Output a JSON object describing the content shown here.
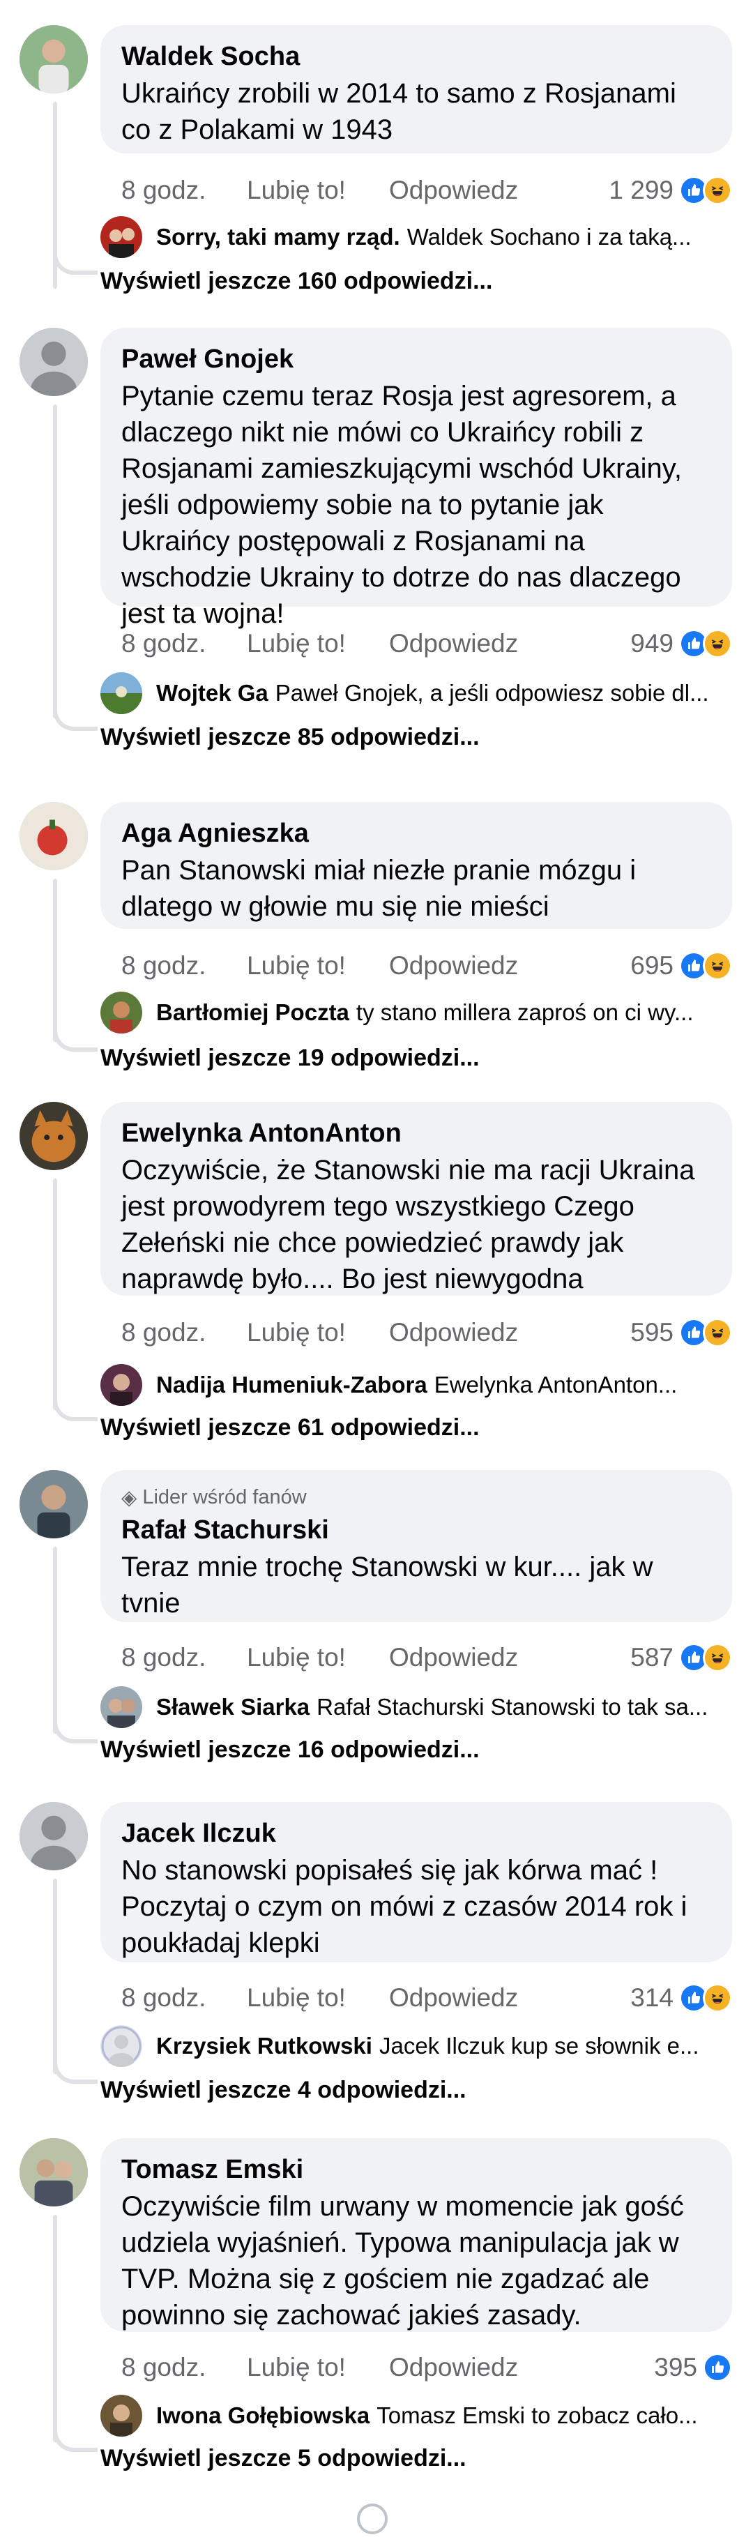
{
  "comments": [
    {
      "author": "Waldek Socha",
      "text": "Ukraińcy zrobili w 2014 to samo z Rosjanami co z Polakami w 1943",
      "time": "8 godz.",
      "like_label": "Lubię to!",
      "reply_label": "Odpowiedz",
      "reaction_count": "1 299",
      "reactions": [
        "like",
        "haha"
      ],
      "reply": {
        "author": "Sorry, taki mamy rząd.",
        "text": "Waldek Sochano i za taką..."
      },
      "more_replies": "Wyświetl jeszcze 160 odpowiedzi..."
    },
    {
      "author": "Paweł Gnojek",
      "text": "Pytanie czemu teraz Rosja jest agresorem, a dlaczego nikt nie mówi co Ukraińcy robili z Rosjanami zamieszkującymi wschód Ukrainy, jeśli odpowiemy sobie na to pytanie jak Ukraińcy postępowali z Rosjanami na wschodzie Ukrainy to dotrze do nas dlaczego jest ta wojna!",
      "time": "8 godz.",
      "like_label": "Lubię to!",
      "reply_label": "Odpowiedz",
      "reaction_count": "949",
      "reactions": [
        "like",
        "haha"
      ],
      "reply": {
        "author": "Wojtek Ga",
        "text": "Paweł Gnojek, a jeśli odpowiesz sobie dl..."
      },
      "more_replies": "Wyświetl jeszcze 85 odpowiedzi..."
    },
    {
      "author": "Aga Agnieszka",
      "text": "Pan Stanowski miał niezłe pranie mózgu i dlatego w głowie mu się nie mieści",
      "time": "8 godz.",
      "like_label": "Lubię to!",
      "reply_label": "Odpowiedz",
      "reaction_count": "695",
      "reactions": [
        "like",
        "haha"
      ],
      "reply": {
        "author": "Bartłomiej Poczta",
        "text": "ty stano millera zaproś on ci wy..."
      },
      "more_replies": "Wyświetl jeszcze 19 odpowiedzi..."
    },
    {
      "author": "Ewelynka AntonAnton",
      "text": "Oczywiście, że Stanowski nie ma racji Ukraina jest prowodyrem tego wszystkiego Czego Zełeński nie chce powiedzieć prawdy jak naprawdę było.... Bo jest niewygodna",
      "time": "8 godz.",
      "like_label": "Lubię to!",
      "reply_label": "Odpowiedz",
      "reaction_count": "595",
      "reactions": [
        "like",
        "haha"
      ],
      "reply": {
        "author": "Nadija Humeniuk-Zabora",
        "text": "Ewelynka AntonAnton..."
      },
      "more_replies": "Wyświetl jeszcze 61 odpowiedzi..."
    },
    {
      "badge": "Lider wśród fanów",
      "author": "Rafał Stachurski",
      "text": "Teraz mnie trochę Stanowski w kur.... jak w tvnie",
      "time": "8 godz.",
      "like_label": "Lubię to!",
      "reply_label": "Odpowiedz",
      "reaction_count": "587",
      "reactions": [
        "like",
        "haha"
      ],
      "reply": {
        "author": "Sławek Siarka",
        "text": "Rafał Stachurski Stanowski to tak sa..."
      },
      "more_replies": "Wyświetl jeszcze 16 odpowiedzi..."
    },
    {
      "author": "Jacek Ilczuk",
      "text": "No stanowski popisałeś się jak kórwa mać ! Poczytaj o czym on mówi z czasów 2014 rok i poukładaj klepki",
      "time": "8 godz.",
      "like_label": "Lubię to!",
      "reply_label": "Odpowiedz",
      "reaction_count": "314",
      "reactions": [
        "like",
        "haha"
      ],
      "reply": {
        "author": "Krzysiek Rutkowski",
        "text": "Jacek Ilczuk kup se słownik e..."
      },
      "more_replies": "Wyświetl jeszcze 4 odpowiedzi..."
    },
    {
      "author": "Tomasz Emski",
      "text": "Oczywiście film urwany w momencie jak gość udziela wyjaśnień. Typowa manipulacja jak w TVP. Można się z gościem nie zgadzać ale powinno się zachować jakieś zasady.",
      "time": "8 godz.",
      "like_label": "Lubię to!",
      "reply_label": "Odpowiedz",
      "reaction_count": "395",
      "reactions": [
        "like"
      ],
      "reply": {
        "author": "Iwona Gołębiowska",
        "text": "Tomasz Emski to zobacz cało..."
      },
      "more_replies": "Wyświetl jeszcze 5 odpowiedzi..."
    }
  ],
  "colors": {
    "like": "#1877f2",
    "haha": "#f7b125",
    "bubble": "#f0f2f5",
    "meta": "#65676b"
  }
}
